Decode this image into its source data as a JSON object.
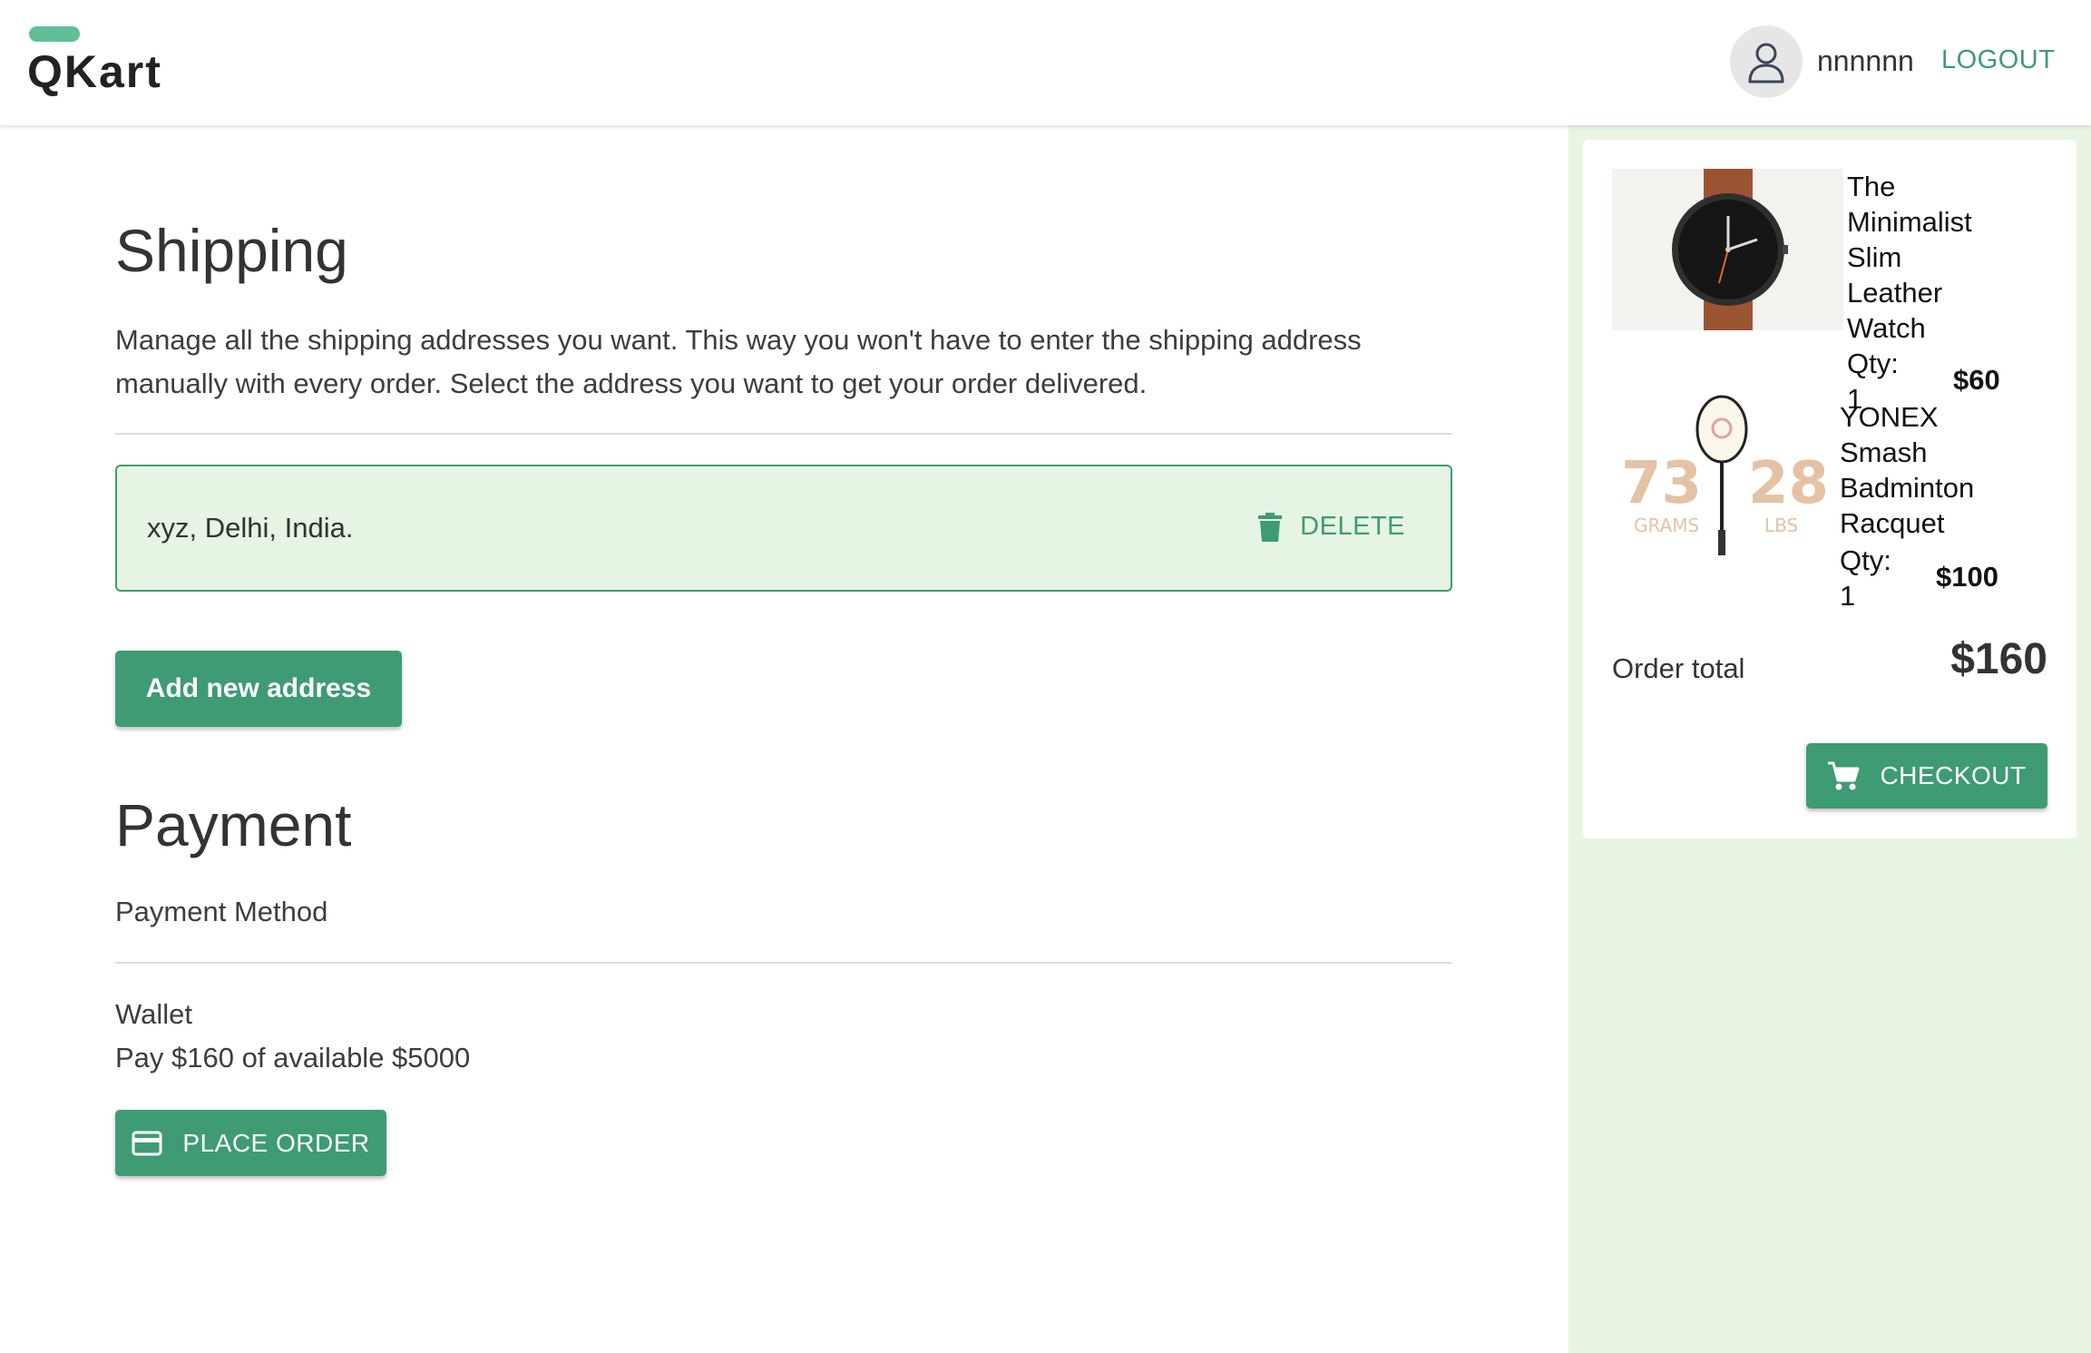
{
  "header": {
    "logo": "QKart",
    "username": "nnnnnn",
    "logout_label": "LOGOUT"
  },
  "shipping": {
    "title": "Shipping",
    "description": "Manage all the shipping addresses you want. This way you won't have to enter the shipping address manually with every order. Select the address you want to get your order delivered.",
    "addresses": [
      {
        "text": "xyz, Delhi, India.",
        "delete_label": "DELETE"
      }
    ],
    "add_button_label": "Add new address"
  },
  "payment": {
    "title": "Payment",
    "method_label": "Payment Method",
    "wallet_label": "Wallet",
    "wallet_desc": "Pay $160 of available $5000",
    "place_order_label": "PLACE ORDER"
  },
  "cart": {
    "items": [
      {
        "name": "The Minimalist Slim Leather Watch",
        "qty": "Qty: 1",
        "price": "$60",
        "image": "watch-image"
      },
      {
        "name": "YONEX Smash Badminton Racquet",
        "qty": "Qty: 1",
        "price": "$100",
        "image": "racquet-image",
        "image_text": {
          "grams": "73",
          "grams_unit": "GRAMS",
          "lbs": "28",
          "lbs_unit": "LBS"
        }
      }
    ],
    "total_label": "Order total",
    "total_value": "$160",
    "checkout_label": "CHECKOUT"
  },
  "colors": {
    "primary": "#3e9b74",
    "sidebar_bg": "#e8f5e3",
    "address_bg": "#e6f4e3"
  }
}
